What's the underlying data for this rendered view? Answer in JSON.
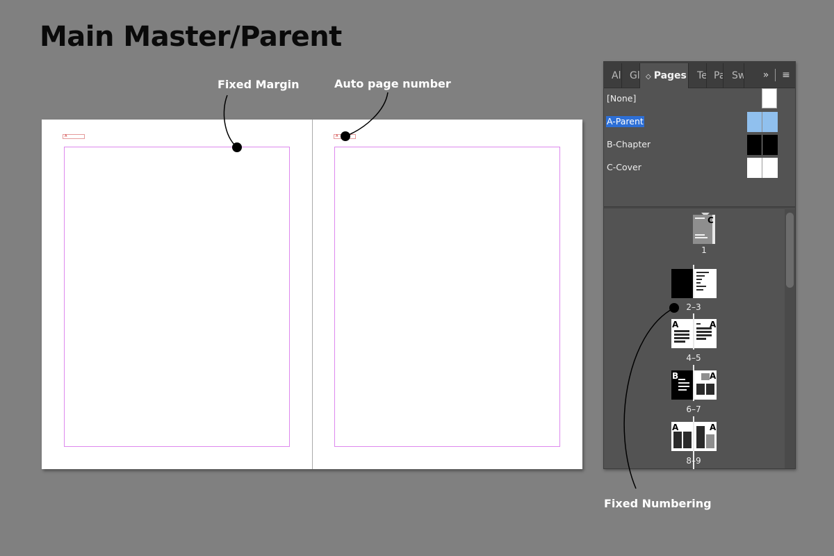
{
  "heading": "Main Master/Parent",
  "callouts": {
    "fixed_margin": "Fixed Margin",
    "auto_page_number": "Auto page number",
    "fixed_numbering": "Fixed Numbering"
  },
  "spread": {
    "page_number_marker": "A"
  },
  "panel": {
    "tabs": [
      {
        "label": "Al"
      },
      {
        "label": "Gl"
      },
      {
        "label": "Pages",
        "active": true
      },
      {
        "label": "Te"
      },
      {
        "label": "Pa"
      },
      {
        "label": "Sw"
      }
    ],
    "more_icon": "»",
    "menu_icon": "≡",
    "masters": [
      {
        "label": "[None]",
        "thumb": "white-single"
      },
      {
        "label": "A-Parent",
        "thumb": "blue-pair",
        "selected": true
      },
      {
        "label": "B-Chapter",
        "thumb": "black-pair"
      },
      {
        "label": "C-Cover",
        "thumb": "white-pair"
      }
    ],
    "pages": [
      {
        "label": "1",
        "applied": [
          "",
          "C"
        ]
      },
      {
        "label": "2–3",
        "applied": [
          "",
          ""
        ]
      },
      {
        "label": "4–5",
        "applied": [
          "A",
          "A"
        ]
      },
      {
        "label": "6–7",
        "applied": [
          "B",
          "A"
        ]
      },
      {
        "label": "8–9",
        "applied": [
          "A",
          "A"
        ]
      }
    ]
  },
  "colors": {
    "background": "#808080",
    "panel_bg": "#535353",
    "selection": "#2d6fd6",
    "parent_thumb": "#90c0ee",
    "margin_guide": "#dd88ee"
  }
}
